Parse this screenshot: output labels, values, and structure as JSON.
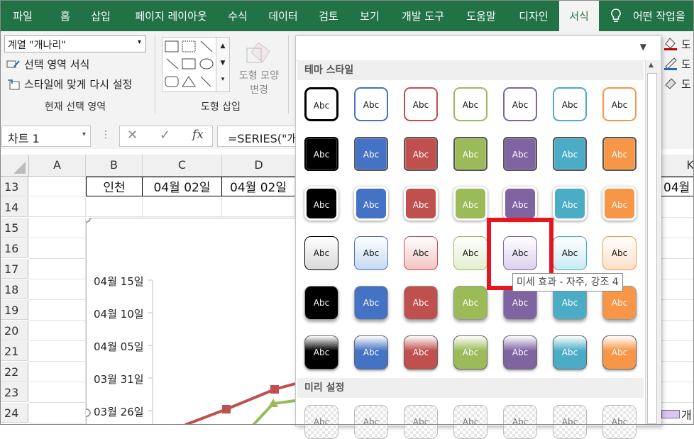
{
  "tabs": [
    "파일",
    "홈",
    "삽입",
    "페이지 레이아웃",
    "수식",
    "데이터",
    "검토",
    "보기",
    "개발 도구",
    "도움말",
    "디자인",
    "서식",
    "어떤 작업을"
  ],
  "active_tab": "서식",
  "ribbon": {
    "element_select": "계열 \"개나리\"",
    "format_selection": "선택 영역 서식",
    "reset_style": "스타일에 맞게 다시 설정",
    "group_current": "현재 선택 영역",
    "group_insert_shape": "도형 삽입",
    "change_shape_1": "도형 모양",
    "change_shape_2": "변경",
    "right_cut": "도"
  },
  "formula_bar": {
    "name_box": "차트 1",
    "formula": "=SERIES(\"개"
  },
  "grid": {
    "columns": [
      "A",
      "B",
      "C",
      "D",
      "K"
    ],
    "rows": [
      "13",
      "14",
      "15",
      "16",
      "17",
      "18",
      "19",
      "20",
      "21",
      "22",
      "23",
      "24"
    ],
    "row13": {
      "B": "인천",
      "C": "04월 02일",
      "D": "04월 02일",
      "K": "04월"
    }
  },
  "chart": {
    "y_ticks": [
      "04월 15일",
      "04월 10일",
      "04월 05일",
      "03월 31일",
      "03월 26일"
    ],
    "legend_cut": "개"
  },
  "gallery": {
    "theme_styles_header": "테마 스타일",
    "presets_header": "미리 설정",
    "swatch_text": "Abc",
    "tooltip": "미세 효과 - 자주, 강조 4",
    "accent_colors": [
      "#000000",
      "#4472c4",
      "#c0504d",
      "#9bbb59",
      "#8064a2",
      "#4bacc6",
      "#f79646"
    ]
  }
}
